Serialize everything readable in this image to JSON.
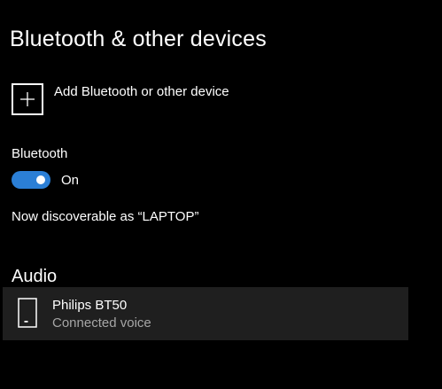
{
  "page": {
    "title": "Bluetooth & other devices"
  },
  "add_device": {
    "label": "Add Bluetooth or other device",
    "icon": "plus-icon"
  },
  "bluetooth": {
    "label": "Bluetooth",
    "toggle_on": true,
    "state_text": "On",
    "accent_color": "#2b7fd6",
    "discoverable_text": "Now discoverable as “LAPTOP”"
  },
  "audio": {
    "heading": "Audio",
    "devices": [
      {
        "name": "Philips BT50",
        "status": "Connected voice",
        "icon": "phone-device-icon"
      }
    ]
  },
  "colors": {
    "background": "#000000",
    "device_row_background": "#1f1f1f",
    "secondary_text": "#a6a6a6"
  }
}
